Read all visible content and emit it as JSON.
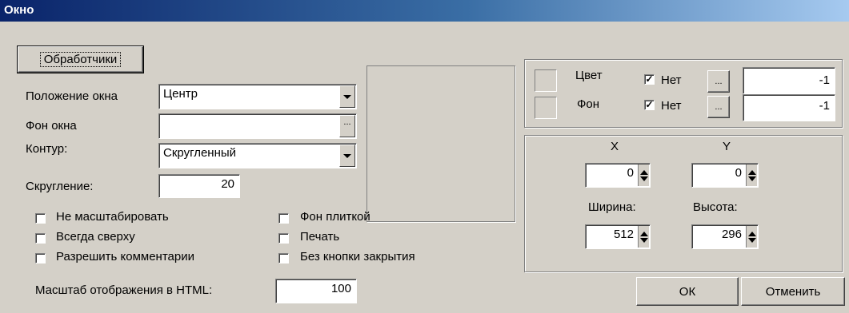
{
  "window": {
    "title": "Окно"
  },
  "buttons": {
    "handlers": "Обработчики",
    "ok": "ОК",
    "cancel": "Отменить"
  },
  "form": {
    "position_label": "Положение окна",
    "position_value": "Центр",
    "background_label": "Фон окна",
    "background_value": "",
    "contour_label": "Контур:",
    "contour_value": "Скругленный",
    "rounding_label": "Скругление:",
    "rounding_value": "20",
    "html_scale_label": "Масштаб отображения в HTML:",
    "html_scale_value": "100"
  },
  "checkboxes": {
    "no_scale": {
      "label": "Не масштабировать",
      "checked": false
    },
    "always_on_top": {
      "label": "Всегда сверху",
      "checked": false
    },
    "allow_comments": {
      "label": "Разрешить комментарии",
      "checked": false
    },
    "tiled_bg": {
      "label": "Фон плиткой",
      "checked": false
    },
    "print": {
      "label": "Печать",
      "checked": false
    },
    "no_close": {
      "label": "Без кнопки закрытия",
      "checked": false
    }
  },
  "colors": {
    "color_label": "Цвет",
    "color_none_label": "Нет",
    "color_none_checked": true,
    "color_value": "-1",
    "bg_label": "Фон",
    "bg_none_label": "Нет",
    "bg_none_checked": true,
    "bg_value": "-1",
    "ellipsis": "..."
  },
  "geometry": {
    "x_label": "X",
    "y_label": "Y",
    "x_value": "0",
    "y_value": "0",
    "width_label": "Ширина:",
    "height_label": "Высота:",
    "width_value": "512",
    "height_value": "296"
  },
  "check_mark": "✓"
}
